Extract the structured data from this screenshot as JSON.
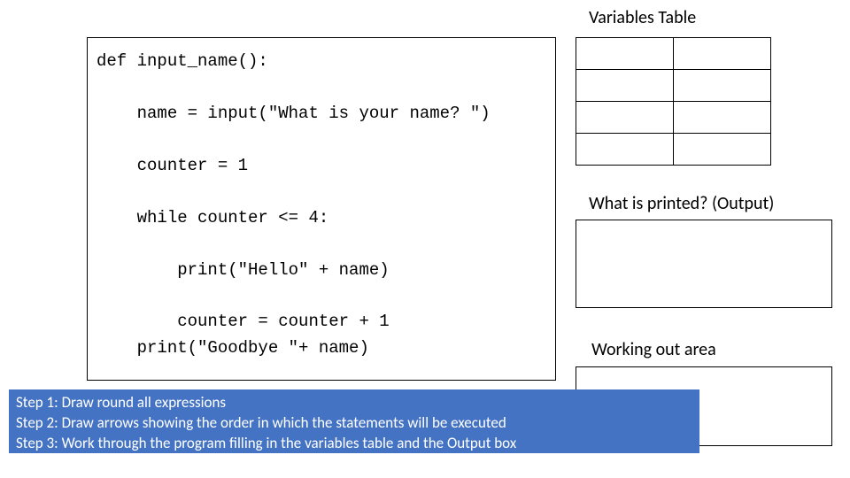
{
  "code_lines": [
    "def input_name():",
    "",
    "    name = input(\"What is your name? \")",
    "",
    "    counter = 1",
    "",
    "    while counter <= 4:",
    "",
    "        print(\"Hello\" + name)",
    "",
    "        counter = counter + 1",
    "    print(\"Goodbye \"+ name)"
  ],
  "variables_title": "Variables Table",
  "variables_rows": 4,
  "variables_cols": 2,
  "output_title": "What is printed? (Output)",
  "working_title": "Working out area",
  "steps": {
    "s1": "Step 1: Draw round all expressions",
    "s2": "Step 2: Draw arrows showing the order in which the  statements will be executed",
    "s3": "Step 3: Work through the program filling in the variables table and the Output box"
  }
}
